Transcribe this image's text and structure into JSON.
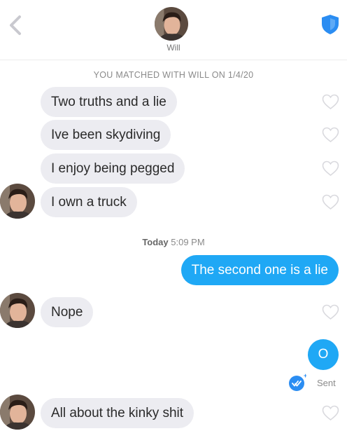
{
  "header": {
    "name": "Will",
    "back_icon": "chevron-left-icon",
    "safety_icon": "shield-icon"
  },
  "match_line": "YOU MATCHED WITH WILL ON 1/4/20",
  "timestamp": {
    "day": "Today",
    "time": "5:09 PM"
  },
  "messages": [
    {
      "from": "them",
      "text": "Two truths and a lie"
    },
    {
      "from": "them",
      "text": "Ive been skydiving"
    },
    {
      "from": "them",
      "text": "I enjoy being pegged"
    },
    {
      "from": "them",
      "text": "I own a truck"
    },
    {
      "from": "me",
      "text": "The second one is a lie"
    },
    {
      "from": "them",
      "text": "Nope"
    },
    {
      "from": "me",
      "text": "O"
    },
    {
      "from": "them",
      "text": "All about the kinky shit"
    }
  ],
  "status": {
    "text": "Sent",
    "icon": "read-receipt-check-icon"
  },
  "colors": {
    "accent": "#1fa8f5",
    "incoming_bubble": "#ececf1",
    "shield": "#2b8df2"
  }
}
